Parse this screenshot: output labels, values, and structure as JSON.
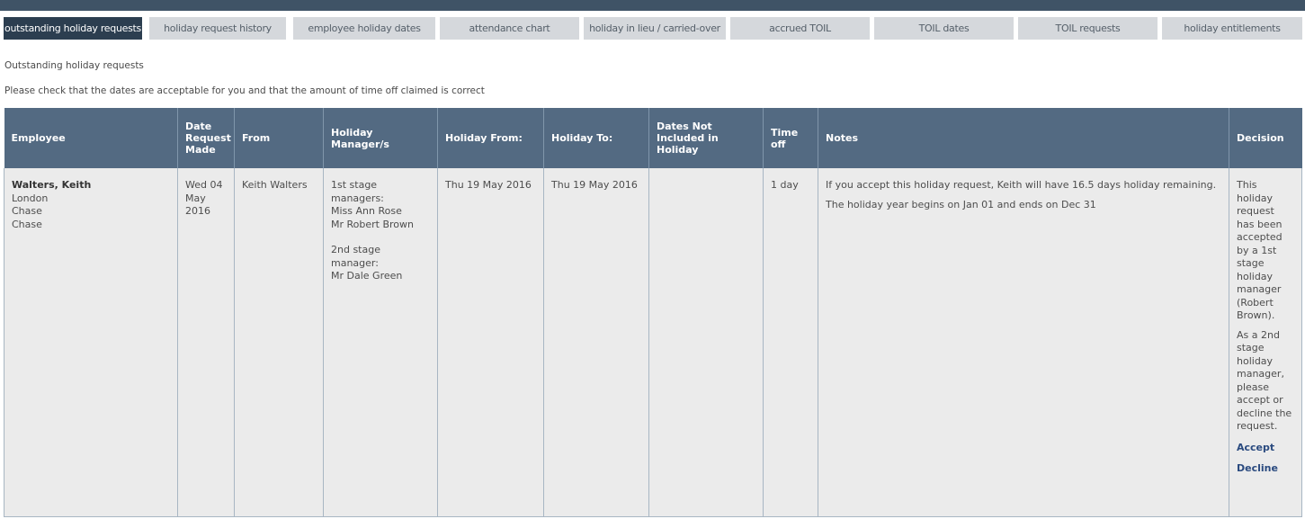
{
  "tabs": [
    {
      "label": "outstanding holiday requests",
      "active": true
    },
    {
      "label": "holiday request history",
      "active": false
    },
    {
      "label": "employee holiday dates",
      "active": false
    },
    {
      "label": "attendance chart",
      "active": false
    },
    {
      "label": "holiday in lieu / carried-over",
      "active": false
    },
    {
      "label": "accrued TOIL",
      "active": false
    },
    {
      "label": "TOIL dates",
      "active": false
    },
    {
      "label": "TOIL requests",
      "active": false
    },
    {
      "label": "holiday entitlements",
      "active": false
    }
  ],
  "page": {
    "heading": "Outstanding holiday requests",
    "instruction": "Please check that the dates are acceptable for you and that the amount of time off claimed is correct"
  },
  "table": {
    "headers": {
      "employee": "Employee",
      "date_request_made": "Date Request Made",
      "from": "From",
      "holiday_managers": "Holiday Manager/s",
      "holiday_from": "Holiday From:",
      "holiday_to": "Holiday To:",
      "dates_not_included": "Dates Not Included in Holiday",
      "time_off": "Time off",
      "notes": "Notes",
      "decision": "Decision"
    },
    "row": {
      "employee_name": "Walters, Keith",
      "employee_location": "London",
      "employee_line2": "Chase",
      "employee_line3": "Chase",
      "date_request_made": "Wed 04 May 2016",
      "from": "Keith Walters",
      "first_stage_label": "1st stage managers:",
      "first_stage_manager_1": "Miss Ann Rose",
      "first_stage_manager_2": "Mr Robert Brown",
      "second_stage_label": "2nd stage manager:",
      "second_stage_manager": "Mr Dale Green",
      "holiday_from": "Thu 19 May 2016",
      "holiday_to": "Thu 19 May 2016",
      "dates_not_included": "",
      "time_off": "1 day",
      "note_1": "If you accept this holiday request, Keith will have 16.5 days holiday remaining.",
      "note_2": "The holiday year begins on Jan 01 and ends on Dec 31",
      "decision_status": "This holiday request has been accepted by a 1st stage holiday manager (Robert Brown).",
      "decision_prompt": "As a 2nd stage holiday manager, please accept or decline the request.",
      "accept_label": "Accept",
      "decline_label": "Decline"
    }
  }
}
